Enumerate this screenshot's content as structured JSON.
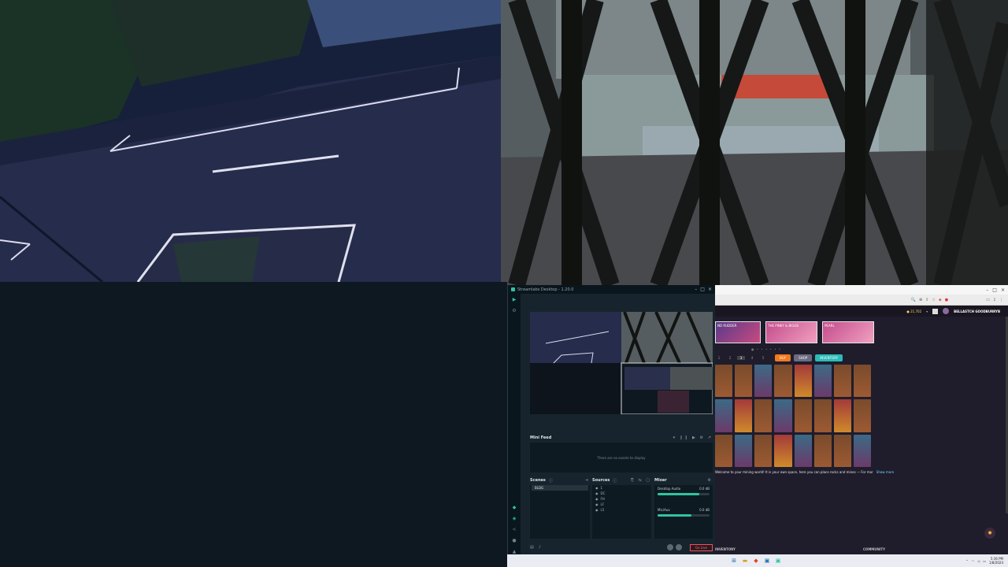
{
  "obs": {
    "title": "Streamlabs Desktop - 1.20.0",
    "minifeed": {
      "title": "Mini Feed",
      "empty_text": "There are no events to display"
    },
    "scenes": {
      "title": "Scenes",
      "items": [
        "BLDG"
      ]
    },
    "sources": {
      "title": "Sources",
      "items": [
        "1",
        "DC",
        "FH",
        "LF",
        "L5"
      ]
    },
    "mixer": {
      "title": "Mixer",
      "channels": [
        {
          "name": "Desktop Audio",
          "db": "0.0 dB",
          "level": 0.8
        },
        {
          "name": "Mic/Aux",
          "db": "0.0 dB",
          "level": 0.65
        }
      ]
    },
    "go_live_label": "Go Live"
  },
  "browser": {
    "coins": "21,702",
    "username": "BELLASTCH GOODBURRYB",
    "banners": [
      "ND RUDDER",
      "THE PINKY & BIGGS",
      "PEARL"
    ],
    "tabs": [
      "1",
      "2",
      "3",
      "4",
      "5"
    ],
    "chips": [
      "BUY",
      "SHOP",
      "INVENTORY"
    ],
    "chat_text": "Welcome to your mining world! It is your own space, here you can place rocks and mines — For mor",
    "chat_link": "Show more",
    "footer": [
      "INVENTORY",
      "COMMUNITY"
    ]
  },
  "taskbar": {
    "time": "5:36 PM",
    "date": "1/8/2024"
  },
  "colors": {
    "accent": "#31c3a2",
    "live": "#fb4a60",
    "orange": "#f07a1e",
    "teal": "#2bbbb8"
  }
}
